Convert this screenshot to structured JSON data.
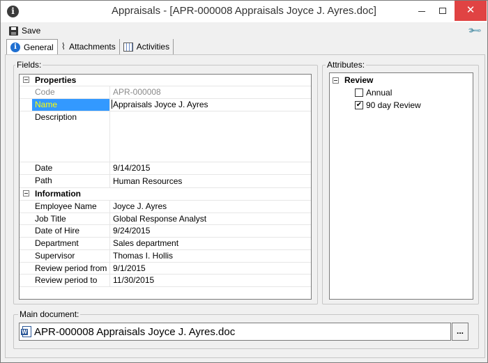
{
  "window": {
    "title": "Appraisals - [APR-000008 Appraisals Joyce J. Ayres.doc]",
    "title_icon": "info-icon",
    "minimize_icon": "minimize-icon",
    "maximize_icon": "maximize-icon",
    "close_icon": "close-icon",
    "close_glyph": "✕"
  },
  "toolbar": {
    "save_label": "Save",
    "save_icon": "floppy-disk-icon",
    "settings_icon": "wrench-icon",
    "settings_glyph": "🔧"
  },
  "tabs": [
    {
      "label": "General",
      "icon": "info-icon",
      "active": true
    },
    {
      "label": "Attachments",
      "icon": "paperclip-icon",
      "active": false
    },
    {
      "label": "Activities",
      "icon": "calendar-icon",
      "active": false
    }
  ],
  "fields": {
    "group_label": "Fields:",
    "categories": {
      "properties": "Properties",
      "information": "Information"
    },
    "rows": [
      {
        "key": "Code",
        "value": "APR-000008"
      },
      {
        "key": "Name",
        "value": "Appraisals Joyce J. Ayres"
      },
      {
        "key": "Description",
        "value": ""
      },
      {
        "key": "Date",
        "value": "9/14/2015"
      },
      {
        "key": "Path",
        "value": "Human Resources"
      },
      {
        "key": "Employee Name",
        "value": "Joyce J. Ayres"
      },
      {
        "key": "Job Title",
        "value": "Global Response Analyst"
      },
      {
        "key": "Date of Hire",
        "value": "9/24/2015"
      },
      {
        "key": "Department",
        "value": "Sales department"
      },
      {
        "key": "Supervisor",
        "value": "Thomas I. Hollis"
      },
      {
        "key": "Review period from",
        "value": "9/1/2015"
      },
      {
        "key": "Review period to",
        "value": "11/30/2015"
      }
    ]
  },
  "attributes": {
    "group_label": "Attributes:",
    "root": "Review",
    "items": [
      {
        "label": "Annual",
        "checked": false
      },
      {
        "label": "90 day Review",
        "checked": true
      }
    ],
    "check_glyph": "✔"
  },
  "main_document": {
    "group_label": "Main document:",
    "file_name": "APR-000008 Appraisals Joyce J. Ayres.doc",
    "file_icon": "word-document-icon",
    "browse_label": "..."
  },
  "colors": {
    "selection": "#3399ff",
    "selection_text": "#ffff00",
    "close_button": "#e04343",
    "info_icon": "#1f6fd1"
  }
}
